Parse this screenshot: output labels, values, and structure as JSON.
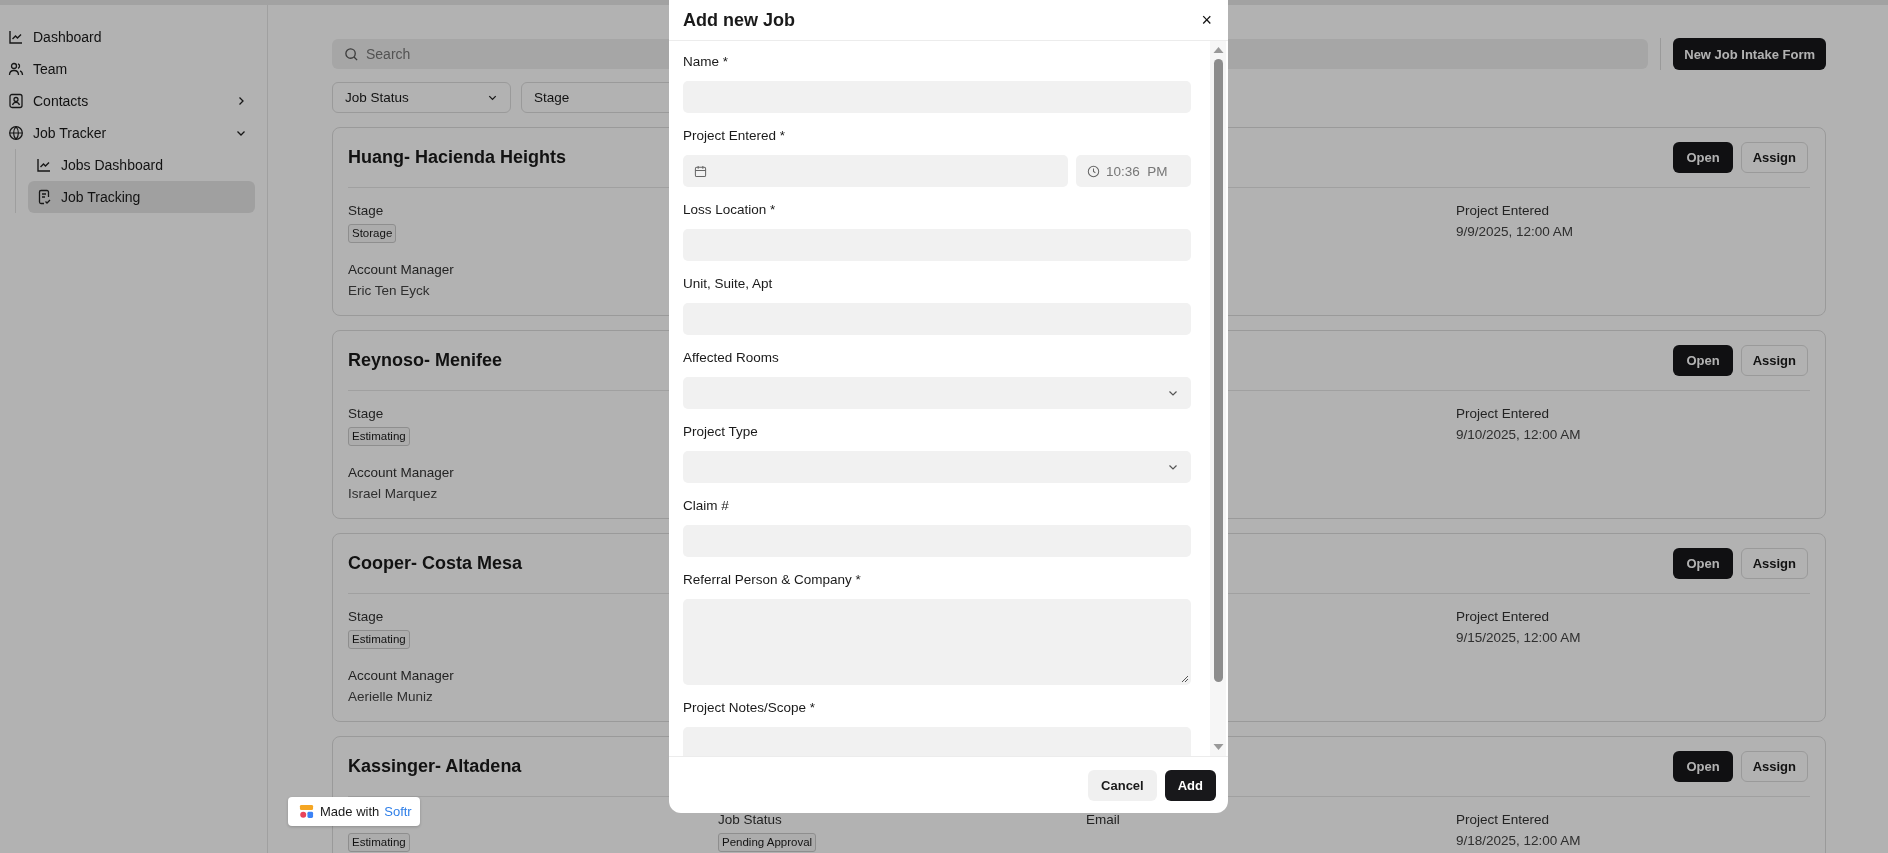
{
  "sidebar": {
    "items": [
      {
        "label": "Dashboard",
        "selected": false
      },
      {
        "label": "Team",
        "selected": false
      },
      {
        "label": "Contacts",
        "selected": false,
        "expanded": false
      },
      {
        "label": "Job Tracker",
        "selected": false,
        "expanded": true,
        "children": [
          {
            "label": "Jobs Dashboard",
            "selected": false
          },
          {
            "label": "Job Tracking",
            "selected": true
          }
        ]
      }
    ]
  },
  "search": {
    "placeholder": "Search"
  },
  "new_job_button": "New Job Intake Form",
  "filters": [
    "Job Status",
    "Stage"
  ],
  "cards": [
    {
      "title": "Huang- Hacienda Heights",
      "open": "Open",
      "assign": "Assign",
      "stage": {
        "label": "Stage",
        "tag": "Storage"
      },
      "account_manager": {
        "label": "Account Manager",
        "value": "Eric Ten Eyck"
      },
      "project_entered": {
        "label": "Project Entered",
        "value": "9/9/2025, 12:00 AM"
      }
    },
    {
      "title": "Reynoso- Menifee",
      "open": "Open",
      "assign": "Assign",
      "stage": {
        "label": "Stage",
        "tag": "Estimating"
      },
      "account_manager": {
        "label": "Account Manager",
        "value": "Israel Marquez"
      },
      "project_entered": {
        "label": "Project Entered",
        "value": "9/10/2025, 12:00 AM"
      }
    },
    {
      "title": "Cooper- Costa Mesa",
      "open": "Open",
      "assign": "Assign",
      "stage": {
        "label": "Stage",
        "tag": "Estimating"
      },
      "account_manager": {
        "label": "Account Manager",
        "value": "Aerielle Muniz"
      },
      "project_entered": {
        "label": "Project Entered",
        "value": "9/15/2025, 12:00 AM"
      }
    },
    {
      "title": "Kassinger- Altadena",
      "open": "Open",
      "assign": "Assign",
      "stage": {
        "tag": "Estimating"
      },
      "job_status": {
        "label": "Job Status",
        "tag": "Pending Approval"
      },
      "email": {
        "label": "Email"
      },
      "project_entered": {
        "label": "Project Entered",
        "value": "9/18/2025, 12:00 AM"
      }
    }
  ],
  "badge": {
    "text": "Made with",
    "brand": "Softr"
  },
  "modal": {
    "title": "Add new Job",
    "close": "×",
    "fields": [
      {
        "kind": "text",
        "label": "Name *"
      },
      {
        "kind": "datetime",
        "label": "Project Entered *",
        "time_placeholder": "10:36  PM"
      },
      {
        "kind": "text",
        "label": "Loss Location *"
      },
      {
        "kind": "text",
        "label": "Unit, Suite, Apt"
      },
      {
        "kind": "select",
        "label": "Affected Rooms"
      },
      {
        "kind": "select",
        "label": "Project Type"
      },
      {
        "kind": "text",
        "label": "Claim #"
      },
      {
        "kind": "textarea",
        "label": "Referral Person & Company *"
      },
      {
        "kind": "textarea",
        "label": "Project Notes/Scope *"
      }
    ],
    "cancel": "Cancel",
    "add": "Add"
  }
}
